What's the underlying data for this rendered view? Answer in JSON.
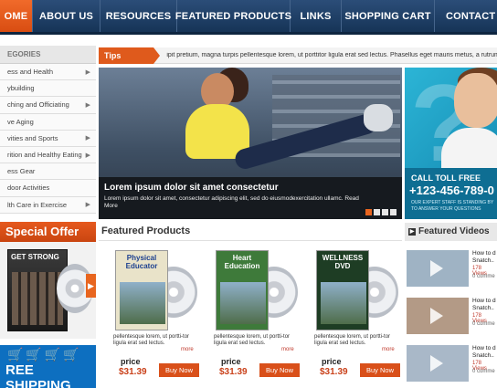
{
  "nav": {
    "items": [
      "OME",
      "ABOUT US",
      "RESOURCES",
      "FEATURED PRODUCTS",
      "LINKS",
      "SHOPPING CART",
      "CONTACT U"
    ],
    "active_index": 0
  },
  "sidebar": {
    "heading": "EGORIES",
    "items": [
      {
        "label": "ess and Health",
        "has_arrow": true
      },
      {
        "label": "ybuilding",
        "has_arrow": false
      },
      {
        "label": "ching and Officiating",
        "has_arrow": true
      },
      {
        "label": "ve Aging",
        "has_arrow": false
      },
      {
        "label": "vities and Sports",
        "has_arrow": true
      },
      {
        "label": "rition and Healthy Eating",
        "has_arrow": true
      },
      {
        "label": "ess Gear",
        "has_arrow": false
      },
      {
        "label": "door Activities",
        "has_arrow": false
      },
      {
        "label": "lth Care in Exercise",
        "has_arrow": true
      }
    ]
  },
  "special_offer": {
    "title": "Special Offer",
    "dvd_title": "GET STRONG",
    "shipping_text": "REE SHIPPING"
  },
  "ticker": {
    "label": "Tips Ticker",
    "text": "ipit pretium, magna turpis pellentesque lorem, ut porttitor ligula erat sed lectus. Phasellus eget mauris metus, a rutrum.."
  },
  "hero": {
    "title": "Lorem ipsum dolor sit amet consectetur",
    "text": "Lorem ipsum dolor sit amet, consectetur adipiscing elit, sed do eiusmodexercitation ullamc. Read More",
    "slide_count": 4,
    "active_slide": 0
  },
  "call_ad": {
    "label": "CALL TOLL FREE",
    "phone": "+123-456-789-0",
    "subtext": "OUR EXPERT STAFF IS STANDING BY TO ANSWER YOUR QUESTIONS"
  },
  "featured_products": {
    "title": "Featured Products",
    "items": [
      {
        "cover_title": "Physical Educator",
        "description": "pellentesque lorem, ut portti-tor ligula erat sed lectus.",
        "more": "more",
        "price_label": "price",
        "price": "$31.39",
        "buy_label": "Buy Now",
        "cover_color": "#e9e3c9",
        "title_color": "#1b3f8f"
      },
      {
        "cover_title": "Heart Education",
        "description": "pellentesque lorem, ut portti-tor ligula erat sed lectus.",
        "more": "more",
        "price_label": "price",
        "price": "$31.39",
        "buy_label": "Buy Now",
        "cover_color": "#3e7a3a",
        "title_color": "#ffffff"
      },
      {
        "cover_title": "WELLNESS DVD",
        "description": "pellentesque lorem, ut portti-tor ligula erat sed lectus.",
        "more": "more",
        "price_label": "price",
        "price": "$31.39",
        "buy_label": "Buy Now",
        "cover_color": "#1e3d24",
        "title_color": "#ffffff"
      }
    ]
  },
  "featured_videos": {
    "title": "Featured Videos",
    "items": [
      {
        "title": "How to d Snatch..",
        "views": "178 Views",
        "comments": "0 comme"
      },
      {
        "title": "How to d Snatch..",
        "views": "178 Views",
        "comments": "0 comme"
      },
      {
        "title": "How to d Snatch..",
        "views": "178 Views",
        "comments": "0 comme"
      }
    ]
  },
  "colors": {
    "nav_bg": "#1f3e66",
    "accent_orange": "#e8651f",
    "shipping_blue": "#0d6fc0",
    "call_teal": "#1b9cc6"
  }
}
